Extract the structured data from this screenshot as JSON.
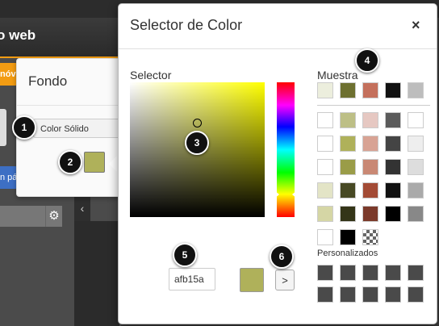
{
  "app": {
    "header_title": "o web",
    "orange_button_label": "nóv",
    "blue_button_label": "n pá",
    "gear_icon": "gear-icon",
    "collapse_icon": "‹"
  },
  "fondo_panel": {
    "title": "Fondo",
    "fill_type": "Color Sólido",
    "swatch_color": "#afb15a"
  },
  "dialog": {
    "title": "Selector de Color",
    "close_label": "×",
    "selector_label": "Selector",
    "hex_value": "afb15a",
    "preview_color": "#afb15a",
    "apply_label": ">",
    "muestra_label": "Muestra",
    "personalizados_label": "Personalizados",
    "muestra_top": [
      "#eceedd",
      "#6d7030",
      "#c4705c",
      "#111111",
      "#bdbdbd"
    ],
    "palette": [
      [
        "#ffffff",
        "#bdbf86",
        "#e6c8c2",
        "#5b5b5b",
        "#ffffff"
      ],
      [
        "#ffffff",
        "#afb15a",
        "#d8a394",
        "#444444",
        "#eeeeee"
      ],
      [
        "#ffffff",
        "#9a9c48",
        "#c98874",
        "#333333",
        "#dddddd"
      ],
      [
        "#e3e4c6",
        "#474924",
        "#a34b35",
        "#111111",
        "#aaaaaa"
      ],
      [
        "#d5d6a5",
        "#343518",
        "#7b3a2b",
        "#000000",
        "#888888"
      ],
      [
        "#ffffff",
        "#000000",
        "checker"
      ]
    ],
    "custom_color": "#4a4a4a"
  },
  "callouts": [
    "1",
    "2",
    "3",
    "4",
    "5",
    "6"
  ]
}
